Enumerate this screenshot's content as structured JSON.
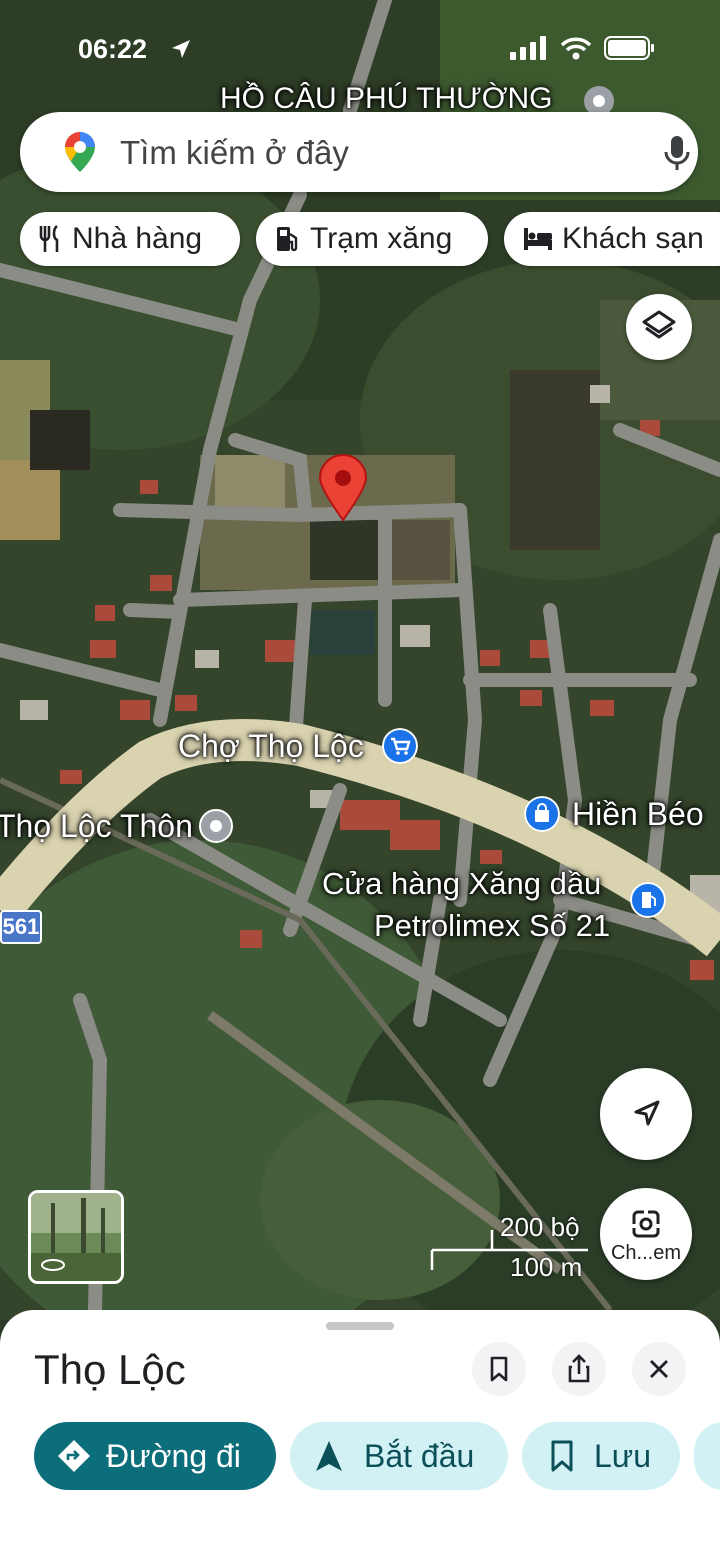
{
  "status_bar": {
    "time": "06:22"
  },
  "search": {
    "placeholder": "Tìm kiếm ở đây"
  },
  "chips": [
    {
      "label": "Nhà hàng",
      "icon": "fork-knife-icon"
    },
    {
      "label": "Trạm xăng",
      "icon": "gas-station-icon"
    },
    {
      "label": "Khách sạn",
      "icon": "bed-icon"
    }
  ],
  "map": {
    "top_label": "HỒ CÂU PHÚ THƯỜNG",
    "labels": {
      "market": "Chợ Thọ Lộc",
      "village": "Thọ Lộc Thôn",
      "shop": "Hiền Béo",
      "gas_line1": "Cửa hàng Xăng dầu",
      "gas_line2": "Petrolimex Số 21",
      "road_number": "561"
    },
    "scale": {
      "imperial": "200 bộ",
      "metric": "100 m"
    },
    "streetview_label": "Ch...em",
    "colors": {
      "pin": "#ea4335",
      "poi_blue": "#1a73e8",
      "road_main": "#d9d3b0"
    }
  },
  "sheet": {
    "title": "Thọ Lộc",
    "actions": {
      "directions": "Đường đi",
      "start": "Bắt đầu",
      "save": "Lưu"
    },
    "colors": {
      "primary": "#0b6e7a",
      "secondary_bg": "#d2f1f5"
    }
  }
}
